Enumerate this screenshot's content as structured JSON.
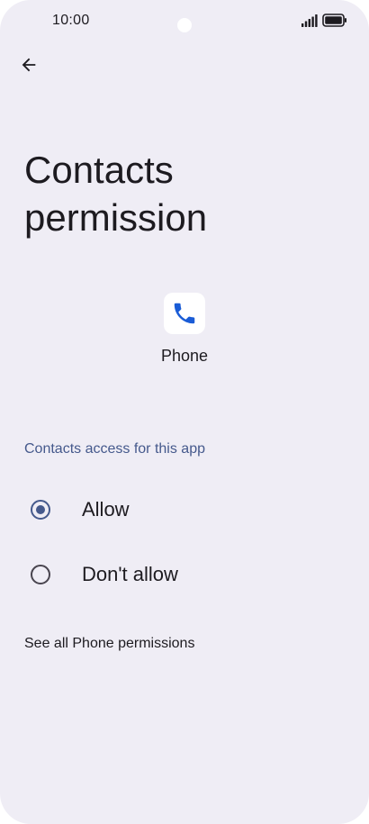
{
  "status_bar": {
    "time": "10:00",
    "signal_icon": "cellular-signal-icon",
    "battery_icon": "battery-full-icon"
  },
  "toolbar": {
    "back_icon": "arrow-back-icon"
  },
  "page": {
    "title": "Contacts permission",
    "app_name": "Phone",
    "app_icon": "phone-app-icon",
    "section_header": "Contacts access for this app",
    "options": [
      {
        "label": "Allow",
        "selected": true
      },
      {
        "label": "Don't allow",
        "selected": false
      }
    ],
    "see_all_link": "See all Phone permissions"
  },
  "colors": {
    "background": "#efedf5",
    "accent": "#45598c",
    "text": "#1d1b20",
    "phone_icon_blue": "#1a5cd6"
  }
}
